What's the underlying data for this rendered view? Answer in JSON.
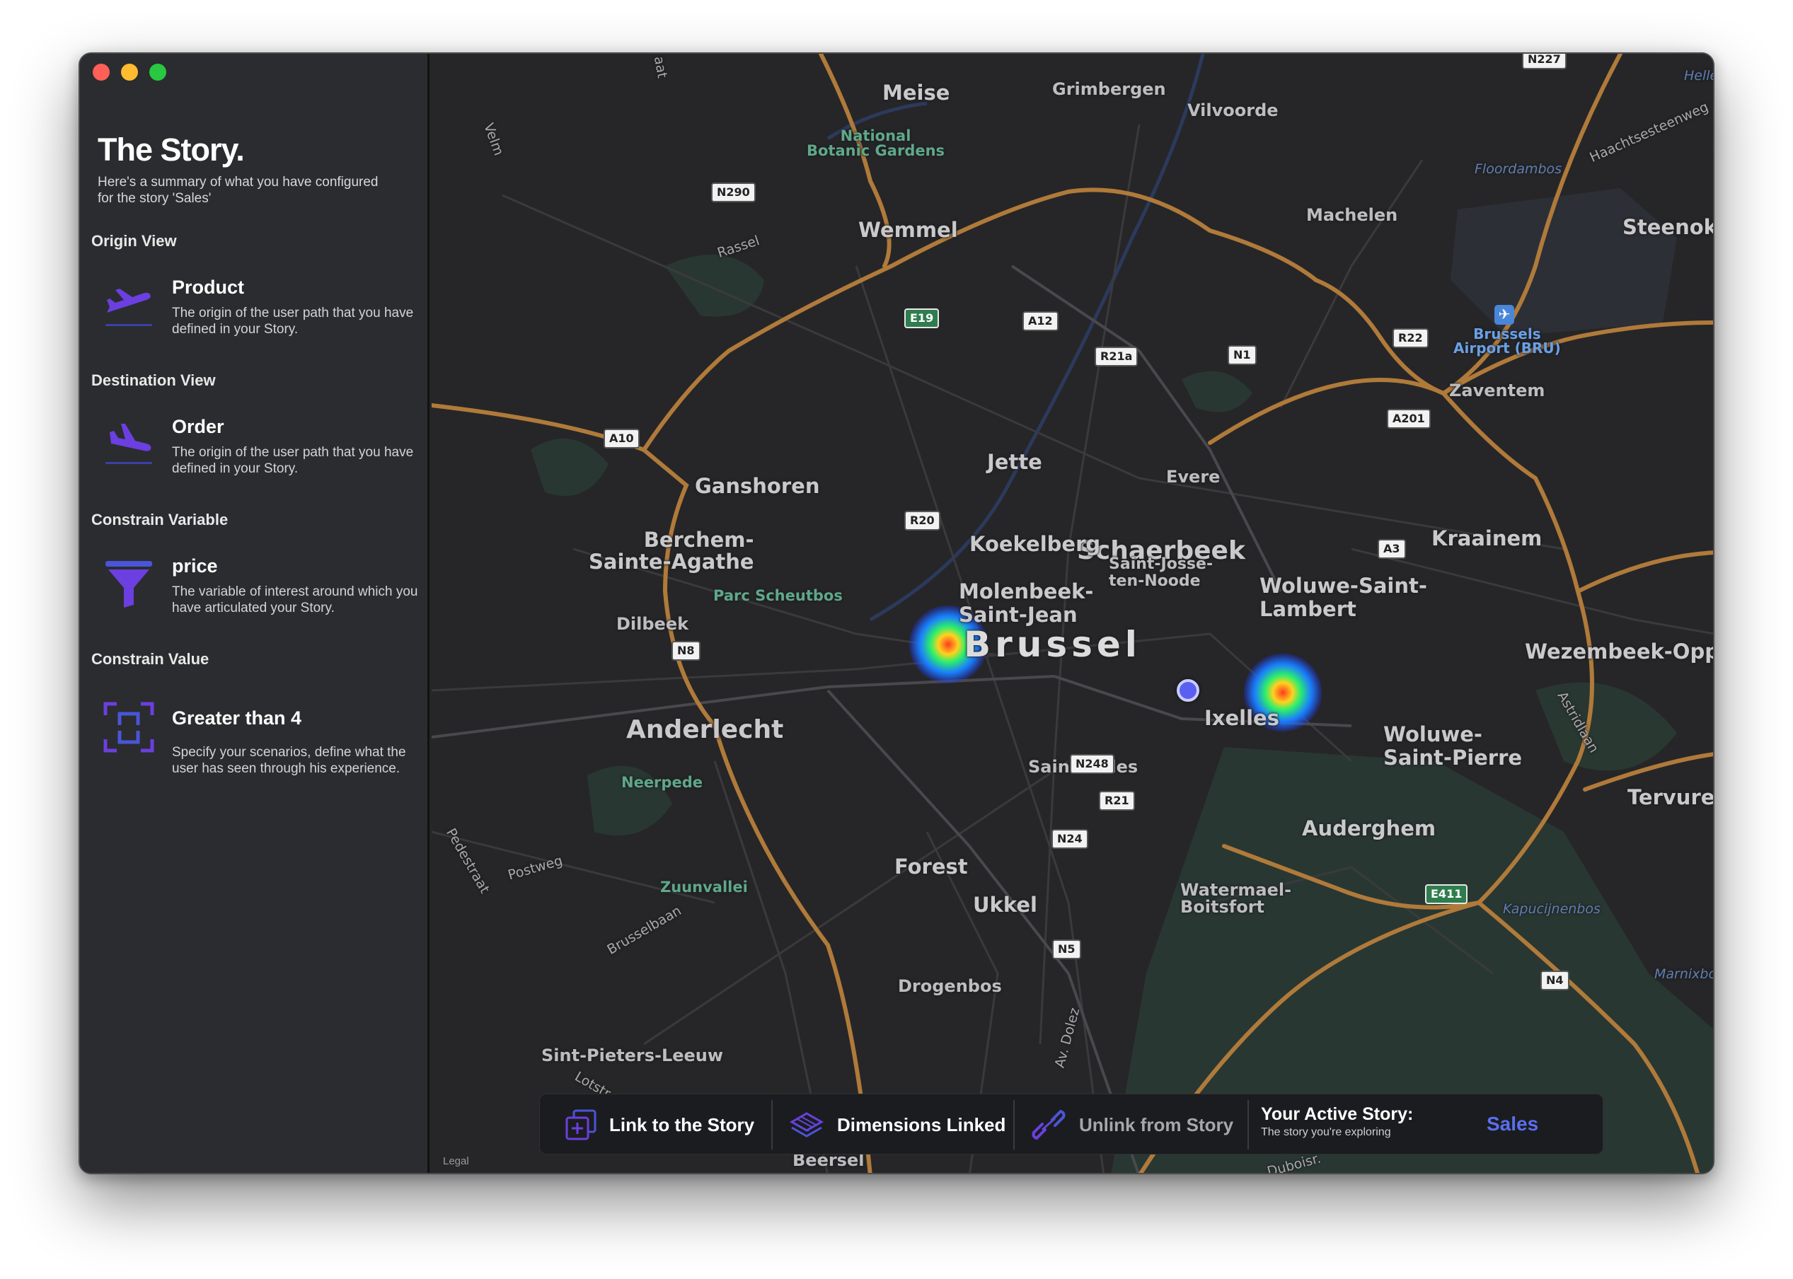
{
  "window": {
    "traffic_lights": [
      "close",
      "minimize",
      "zoom"
    ]
  },
  "sidebar": {
    "title": "The Story.",
    "subtitle": "Here's a summary of what you have configured for the story 'Sales'",
    "sections": [
      {
        "heading": "Origin View",
        "icon": "plane-takeoff-icon",
        "title": "Product",
        "description": "The origin of the user path that you have defined in your Story."
      },
      {
        "heading": "Destination View",
        "icon": "plane-landing-icon",
        "title": "Order",
        "description": "The origin of the user path that you have defined in your Story."
      },
      {
        "heading": "Constrain Variable",
        "icon": "funnel-icon",
        "title": "price",
        "description": "The variable of interest around which you have articulated your Story."
      },
      {
        "heading": "Constrain Value",
        "icon": "scan-value-icon",
        "title": "Greater than 4",
        "description": "Specify your scenarios, define what the user has seen through his experience."
      }
    ]
  },
  "map": {
    "city": "Brussel",
    "places_large": [
      "Schaerbeek",
      "Anderlecht",
      "Molenbeek-\nSaint-Jean",
      "Woluwe-Saint-\nLambert",
      "Woluwe-\nSaint-Pierre",
      "Ixelles",
      "Jette",
      "Ganshoren",
      "Berchem-\nSainte-Agathe",
      "Koekelberg",
      "Kraainem",
      "Auderghem",
      "Forest",
      "Ukkel",
      "Wemmel",
      "Meise",
      "Steenokk",
      "Wezembeek-Oppe",
      "Tervuren"
    ],
    "places_small": [
      "Grimbergen",
      "Vilvoorde",
      "Machelen",
      "Zaventem",
      "Evere",
      "Saint-Josse-\nten-Noode",
      "Dilbeek",
      "Saint-Gilles",
      "Watermael-\nBoitsfort",
      "Drogenbos",
      "Sint-Pieters-Leeuw",
      "Beersel"
    ],
    "parks": [
      "National\nBotanic Gardens",
      "Parc Scheutbos",
      "Neerpede",
      "Zuunvallei"
    ],
    "water_and_woods": [
      "Hellebos",
      "Floordambos",
      "Kapucijnenbos",
      "Marnixbos"
    ],
    "streets": [
      "Rassel",
      "Velm",
      "Haachtsesteenweg",
      "Pedestraat",
      "Postweg",
      "Brusselbaan",
      "Av. Dolez",
      "Astridlaan",
      "Lotstr.",
      "Duboisr.",
      "aat"
    ],
    "airport": "Brussels\nAirport (BRU)",
    "shields": [
      "N290",
      "E19",
      "A12",
      "R21a",
      "N1",
      "R22",
      "A201",
      "A10",
      "R20",
      "A3",
      "N8",
      "N248",
      "R21",
      "N24",
      "N5",
      "E411",
      "N4",
      "N227"
    ],
    "legal": "Legal"
  },
  "toolbar": {
    "link_label": "Link to the Story",
    "dimensions_label": "Dimensions Linked",
    "unlink_label": "Unlink from Story",
    "active_heading": "Your Active Story:",
    "active_sub": "The story you're exploring",
    "active_value": "Sales"
  },
  "colors": {
    "accent": "#5b6ef0",
    "icon_purple": "#6b3fe0",
    "highway": "#b07a3a",
    "sidebar_bg": "#2b2c2f",
    "map_bg": "#262628"
  }
}
